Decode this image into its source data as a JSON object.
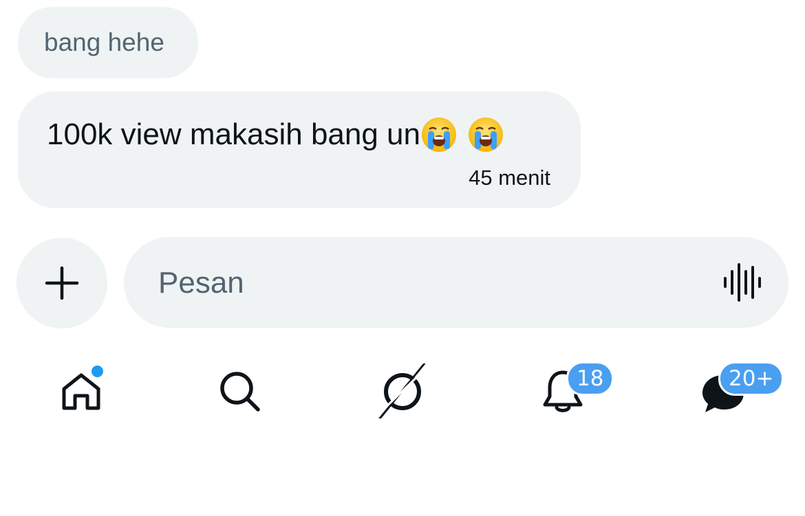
{
  "conversation": {
    "previous_message": {
      "text": "bang hehe"
    },
    "latest_message": {
      "text": "100k view makasih bang un",
      "emojis": [
        "loudly-crying-face-icon",
        "loudly-crying-face-icon"
      ],
      "timestamp": "45 menit"
    }
  },
  "composer": {
    "placeholder": "Pesan",
    "add_icon": "plus-icon",
    "voice_icon": "audio-waveform-icon"
  },
  "tabbar": {
    "items": [
      {
        "name": "home",
        "icon": "home-icon",
        "has_dot": true
      },
      {
        "name": "search",
        "icon": "search-icon"
      },
      {
        "name": "grok",
        "icon": "grok-icon"
      },
      {
        "name": "notifications",
        "icon": "bell-icon",
        "badge": "18"
      },
      {
        "name": "messages",
        "icon": "chat-bubble-icon",
        "badge": "20+"
      }
    ]
  },
  "colors": {
    "bubble_bg": "#eff3f4",
    "muted_text": "#536471",
    "primary_text": "#0f1419",
    "accent": "#1d9bf0"
  }
}
